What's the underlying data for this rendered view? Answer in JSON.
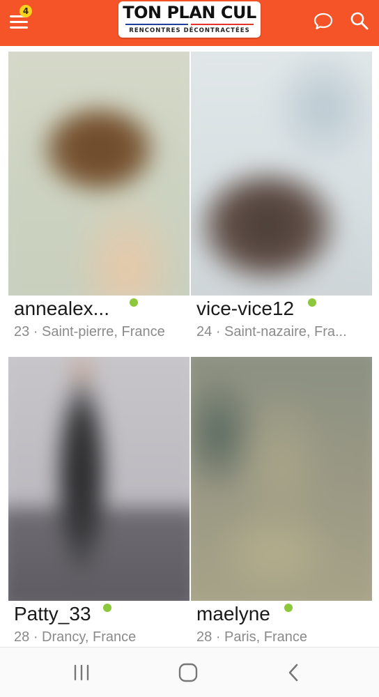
{
  "header": {
    "notification_count": "4",
    "logo_title": "TON PLAN CUL",
    "logo_subtitle": "RENCONTRES DÉCONTRACTÉES",
    "brand_color": "#f45428",
    "icons": [
      "menu-icon",
      "chat-bubble-icon",
      "search-icon"
    ]
  },
  "profiles": [
    {
      "name": "annealex...",
      "age": "23",
      "location": "Saint-pierre, France",
      "online": true
    },
    {
      "name": "vice-vice12",
      "age": "24",
      "location": "Saint-nazaire, Fra...",
      "online": true
    },
    {
      "name": "Patty_33",
      "age": "28",
      "location": "Drancy, France",
      "online": true
    },
    {
      "name": "maelyne",
      "age": "28",
      "location": "Paris, France",
      "online": true
    }
  ],
  "separator": "·",
  "online_color": "#8bc83a",
  "navbar": {
    "icons": [
      "recent-apps-icon",
      "home-icon",
      "back-icon"
    ]
  }
}
